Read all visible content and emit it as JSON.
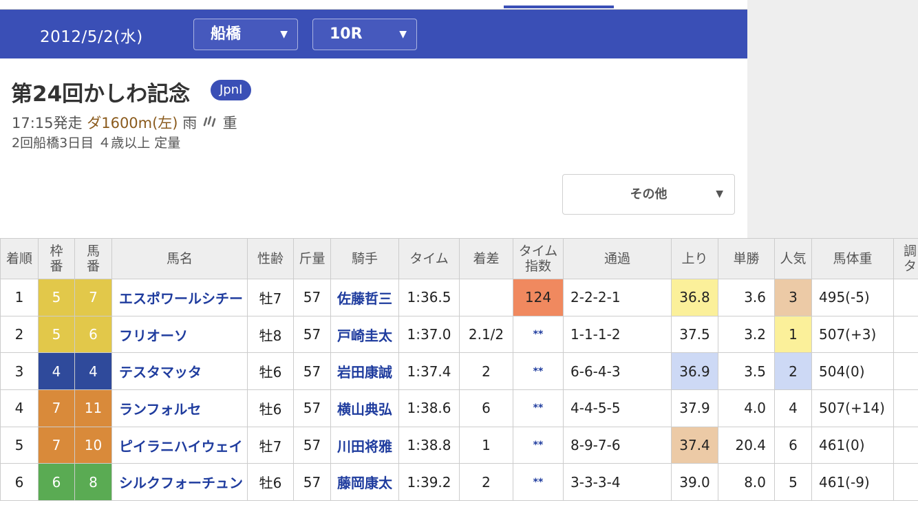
{
  "header": {
    "date": "2012/5/2(水)",
    "venue": "船橋",
    "race_no": "10R"
  },
  "race": {
    "title": "第24回かしわ記念",
    "grade": "JpnI",
    "start": "17:15発走",
    "course": "ダ1600m(左)",
    "weather": "雨",
    "track": "重",
    "info2": "2回船橋3日目 ４歳以上 定量"
  },
  "other_label": "その他",
  "icons": {
    "dropdown": "chevron-down-icon",
    "weather": "rain-icon"
  },
  "colors": {
    "brand": "#3a4fb6",
    "waku5": "#e2c84a",
    "waku4": "#2f4a9b",
    "waku7": "#d98a3a",
    "waku6": "#5aab53",
    "hl_orange": "#f0895f",
    "hl_yellow": "#fbf09a",
    "hl_tan": "#eccaa6",
    "hl_blue": "#cdd9f5"
  },
  "table": {
    "headers": [
      "着順",
      "枠番",
      "馬番",
      "馬名",
      "性齢",
      "斤量",
      "騎手",
      "タイム",
      "着差",
      "タイム指数",
      "通過",
      "上り",
      "単勝",
      "人気",
      "馬体重",
      "調教タイム"
    ],
    "rows": [
      {
        "rank": "1",
        "waku": "5",
        "uma": "7",
        "name": "エスポワールシチー",
        "sex_age": "牡7",
        "weight": "57",
        "jockey": "佐藤哲三",
        "time": "1:36.5",
        "margin": "",
        "index": "124",
        "passing": "2-2-2-1",
        "last3f": "36.8",
        "odds": "3.6",
        "pop": "3",
        "body": "495(-5)"
      },
      {
        "rank": "2",
        "waku": "5",
        "uma": "6",
        "name": "フリオーソ",
        "sex_age": "牡8",
        "weight": "57",
        "jockey": "戸崎圭太",
        "time": "1:37.0",
        "margin": "2.1/2",
        "index": "**",
        "passing": "1-1-1-2",
        "last3f": "37.5",
        "odds": "3.2",
        "pop": "1",
        "body": "507(+3)"
      },
      {
        "rank": "3",
        "waku": "4",
        "uma": "4",
        "name": "テスタマッタ",
        "sex_age": "牡6",
        "weight": "57",
        "jockey": "岩田康誠",
        "time": "1:37.4",
        "margin": "2",
        "index": "**",
        "passing": "6-6-4-3",
        "last3f": "36.9",
        "odds": "3.5",
        "pop": "2",
        "body": "504(0)"
      },
      {
        "rank": "4",
        "waku": "7",
        "uma": "11",
        "name": "ランフォルセ",
        "sex_age": "牡6",
        "weight": "57",
        "jockey": "横山典弘",
        "time": "1:38.6",
        "margin": "6",
        "index": "**",
        "passing": "4-4-5-5",
        "last3f": "37.9",
        "odds": "4.0",
        "pop": "4",
        "body": "507(+14)"
      },
      {
        "rank": "5",
        "waku": "7",
        "uma": "10",
        "name": "ピイラニハイウェイ",
        "sex_age": "牡7",
        "weight": "57",
        "jockey": "川田将雅",
        "time": "1:38.8",
        "margin": "1",
        "index": "**",
        "passing": "8-9-7-6",
        "last3f": "37.4",
        "odds": "20.4",
        "pop": "6",
        "body": "461(0)"
      },
      {
        "rank": "6",
        "waku": "6",
        "uma": "8",
        "name": "シルクフォーチュン",
        "sex_age": "牡6",
        "weight": "57",
        "jockey": "藤岡康太",
        "time": "1:39.2",
        "margin": "2",
        "index": "**",
        "passing": "3-3-3-4",
        "last3f": "39.0",
        "odds": "8.0",
        "pop": "5",
        "body": "461(-9)"
      }
    ]
  }
}
